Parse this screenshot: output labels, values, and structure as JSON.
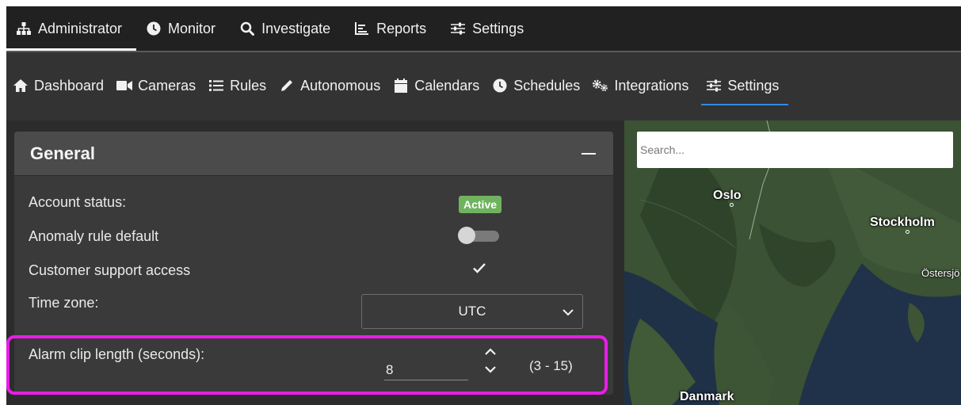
{
  "top_nav": {
    "items": [
      {
        "label": "Administrator",
        "icon": "sitemap-icon",
        "active": true
      },
      {
        "label": "Monitor",
        "icon": "clock-icon"
      },
      {
        "label": "Investigate",
        "icon": "search-icon"
      },
      {
        "label": "Reports",
        "icon": "bar-chart-icon"
      },
      {
        "label": "Settings",
        "icon": "sliders-icon"
      }
    ]
  },
  "sub_nav": {
    "items": [
      {
        "label": "Dashboard",
        "icon": "home-icon"
      },
      {
        "label": "Cameras",
        "icon": "video-camera-icon"
      },
      {
        "label": "Rules",
        "icon": "list-icon"
      },
      {
        "label": "Autonomous",
        "icon": "pencil-icon"
      },
      {
        "label": "Calendars",
        "icon": "calendar-icon"
      },
      {
        "label": "Schedules",
        "icon": "clock-icon"
      },
      {
        "label": "Integrations",
        "icon": "cogs-icon"
      },
      {
        "label": "Settings",
        "icon": "sliders-icon",
        "active": true
      }
    ]
  },
  "general_panel": {
    "title": "General",
    "account_status": {
      "label": "Account status:",
      "value": "Active"
    },
    "anomaly_rule_default": {
      "label": "Anomaly rule default",
      "enabled": false
    },
    "customer_support_access": {
      "label": "Customer support access",
      "checked": true
    },
    "time_zone": {
      "label": "Time zone:",
      "value": "UTC"
    },
    "alarm_clip_length": {
      "label": "Alarm clip length (seconds):",
      "value": "8",
      "range": "(3 - 15)"
    }
  },
  "map": {
    "search_placeholder": "Search...",
    "labels": {
      "oslo": "Oslo",
      "stockholm": "Stockholm",
      "ostersjon": "Östersjö",
      "danmark": "Danmark"
    }
  },
  "colors": {
    "accent": "#2f8be6",
    "badge": "#6fb35f",
    "highlight": "#e91ee6"
  }
}
